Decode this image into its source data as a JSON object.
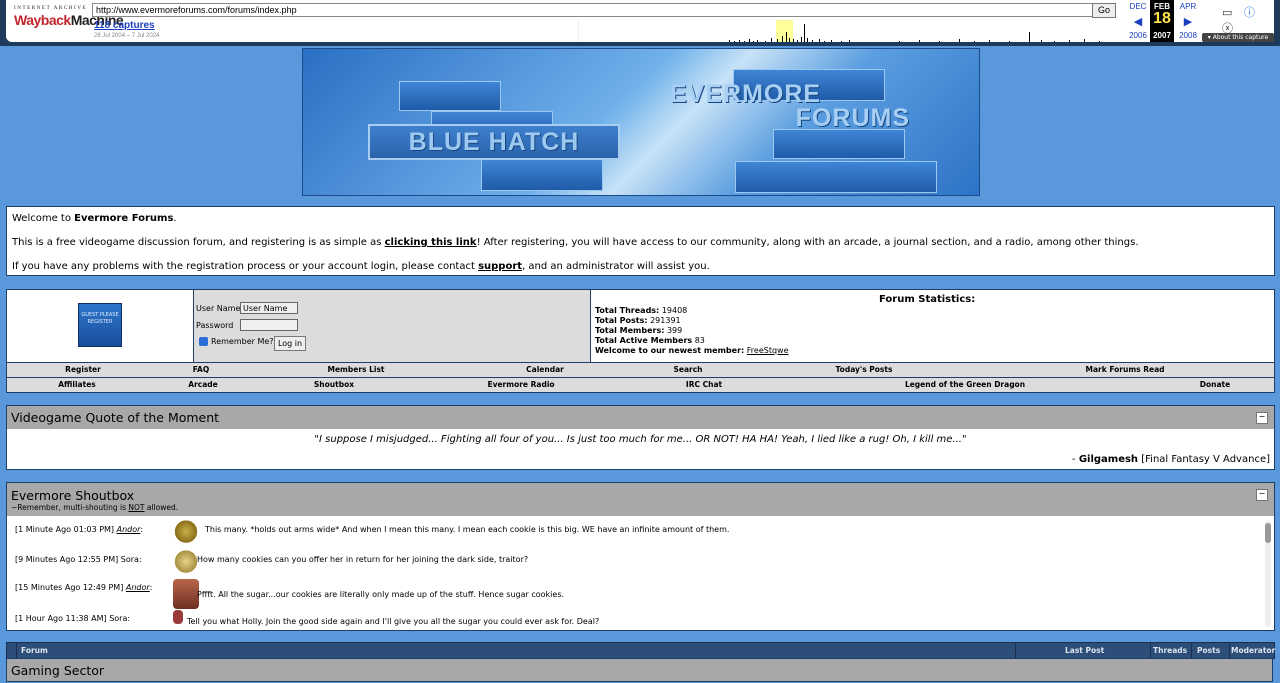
{
  "wayback": {
    "logo_top": "INTERNET ARCHIVE",
    "logo_main_a": "Wayback",
    "logo_main_b": "Machine",
    "url": "http://www.evermoreforums.com/forums/index.php",
    "go_label": "Go",
    "captures": "118 captures",
    "range": "28 Jul 2004 – 7 Jul 2024",
    "prev_month": "DEC",
    "prev_year": "2006",
    "cur_month": "FEB",
    "cur_day": "18",
    "cur_year": "2007",
    "next_month": "APR",
    "next_year": "2008",
    "about": "▾ About this capture"
  },
  "banner": {
    "left_title": "BLUE HATCH",
    "right_title_1": "EVERMORE",
    "right_title_2": "FORUMS"
  },
  "welcome": {
    "line1_a": "Welcome to ",
    "line1_b": "Evermore Forums",
    "line1_c": ".",
    "line2_a": "This is a free videogame discussion forum, and registering is as simple as ",
    "line2_link": "clicking this link",
    "line2_b": "! After registering, you will have access to our community, along with an arcade, a journal section, and a radio, among other things.",
    "line3_a": "If you have any problems with the registration process or your account login, please contact ",
    "line3_link": "support",
    "line3_b": ", and an administrator will assist you."
  },
  "login": {
    "guest_badge": "GUEST PLEASE REGISTER",
    "username_label": "User Name",
    "username_value": "User Name",
    "password_label": "Password",
    "remember_label": "Remember Me?",
    "login_button": "Log in"
  },
  "stats": {
    "title": "Forum Statistics:",
    "threads_label": "Total Threads:",
    "threads": "19408",
    "posts_label": "Total Posts:",
    "posts": "291391",
    "members_label": "Total Members:",
    "members": "399",
    "active_label": "Total Active Members",
    "active": "83",
    "newest_label": "Welcome to our newest member:",
    "newest": "FreeStqwe"
  },
  "nav1": [
    "Register",
    "FAQ",
    "Members List",
    "Calendar",
    "Search",
    "Today's Posts",
    "Mark Forums Read"
  ],
  "nav2": [
    "Affiliates",
    "Arcade",
    "Shoutbox",
    "Evermore Radio",
    "IRC Chat",
    "Legend of the Green Dragon",
    "Donate"
  ],
  "quote": {
    "title": "Videogame Quote of the Moment",
    "text": "\"I suppose I misjudged... Fighting all four of you... Is just too much for me... OR NOT! HA HA! Yeah, I lied like a rug! Oh, I kill me...\"",
    "source_prefix": "- ",
    "source_name": "Gilgamesh",
    "source_game": " [Final Fantasy V Advance]"
  },
  "shoutbox": {
    "title": "Evermore Shoutbox",
    "subtitle_a": "~Remember, multi-shouting is ",
    "subtitle_not": "NOT",
    "subtitle_b": " allowed.",
    "entries": [
      {
        "time": "[1 Minute Ago 01:03 PM]",
        "user": "Andor",
        "msg": "This many. *holds out arms wide* And when I mean this many. I mean each cookie is this big. WE have an infinite amount of them."
      },
      {
        "time": "[9 Minutes Ago 12:55 PM]",
        "user": "Sora",
        "msg": "How many cookies can you offer her in return for her joining the dark side, traitor?"
      },
      {
        "time": "[15 Minutes Ago 12:49 PM]",
        "user": "Andor",
        "msg": "Pffft. All the sugar...our cookies are literally only made up of the stuff. Hence sugar cookies."
      },
      {
        "time": "[1 Hour Ago 11:38 AM]",
        "user": "Sora",
        "msg": "Tell you what Holly. Join the good side again and I'll give you all the sugar you could ever ask for. Deal?"
      }
    ]
  },
  "forum_header": {
    "forum": "Forum",
    "last_post": "Last Post",
    "threads": "Threads",
    "posts": "Posts",
    "moderator": "Moderator"
  },
  "category": "Gaming Sector"
}
